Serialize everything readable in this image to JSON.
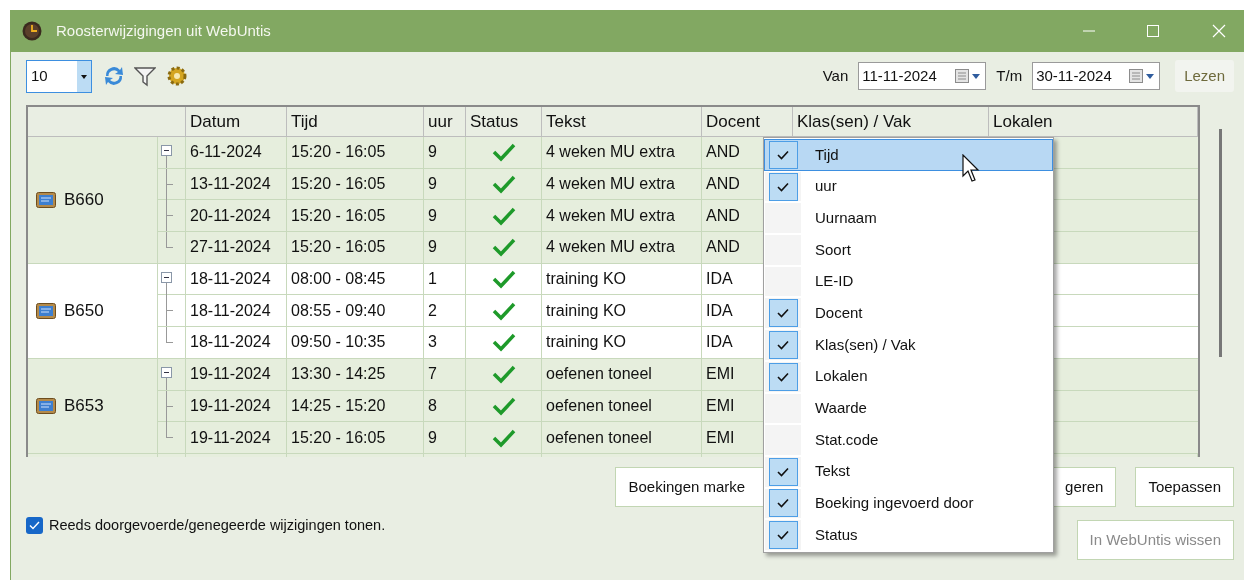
{
  "window": {
    "title": "Roosterwijzigingen uit WebUntis"
  },
  "toolbar": {
    "count": "10",
    "van_label": "Van",
    "van_date": "11-11-2024",
    "tm_label": "T/m",
    "tm_date": "30-11-2024",
    "read_button": {
      "label": "Lezen",
      "disabled": true
    }
  },
  "table": {
    "columns": [
      "Datum",
      "Tijd",
      "uur",
      "Status",
      "Tekst",
      "Docent",
      "Klas(sen) / Vak",
      "Lokalen"
    ],
    "groups": [
      {
        "name": "B660",
        "expanded": true,
        "rows": [
          {
            "datum": "6-11-2024",
            "tijd": "15:20 - 16:05",
            "uur": "9",
            "done": true,
            "tekst": "4 weken MU extra",
            "docent": "AND"
          },
          {
            "datum": "13-11-2024",
            "tijd": "15:20 - 16:05",
            "uur": "9",
            "done": true,
            "tekst": "4 weken MU extra",
            "docent": "AND"
          },
          {
            "datum": "20-11-2024",
            "tijd": "15:20 - 16:05",
            "uur": "9",
            "done": true,
            "tekst": "4 weken MU extra",
            "docent": "AND"
          },
          {
            "datum": "27-11-2024",
            "tijd": "15:20 - 16:05",
            "uur": "9",
            "done": true,
            "tekst": "4 weken MU extra",
            "docent": "AND"
          }
        ]
      },
      {
        "name": "B650",
        "expanded": true,
        "rows": [
          {
            "datum": "18-11-2024",
            "tijd": "08:00 - 08:45",
            "uur": "1",
            "done": true,
            "tekst": "training KO",
            "docent": "IDA"
          },
          {
            "datum": "18-11-2024",
            "tijd": "08:55 - 09:40",
            "uur": "2",
            "done": true,
            "tekst": "training KO",
            "docent": "IDA"
          },
          {
            "datum": "18-11-2024",
            "tijd": "09:50 - 10:35",
            "uur": "3",
            "done": true,
            "tekst": "training KO",
            "docent": "IDA"
          }
        ]
      },
      {
        "name": "B653",
        "expanded": true,
        "rows": [
          {
            "datum": "19-11-2024",
            "tijd": "13:30 - 14:25",
            "uur": "7",
            "done": true,
            "tekst": "oefenen toneel",
            "docent": "EMI"
          },
          {
            "datum": "19-11-2024",
            "tijd": "14:25 - 15:20",
            "uur": "8",
            "done": true,
            "tekst": "oefenen toneel",
            "docent": "EMI"
          },
          {
            "datum": "19-11-2024",
            "tijd": "15:20 - 16:05",
            "uur": "9",
            "done": true,
            "tekst": "oefenen toneel",
            "docent": "EMI"
          }
        ]
      }
    ]
  },
  "show_done": {
    "label": "Reeds doorgevoerde/genegeerde wijzigingen tonen.",
    "checked": true
  },
  "buttons": [
    {
      "label": "Boekingen marke",
      "disabled": false
    },
    {
      "label": "geren",
      "disabled": false
    },
    {
      "label": "Toepassen",
      "disabled": false
    },
    {
      "label": "In WebUntis wissen",
      "disabled": true
    }
  ],
  "column_menu": {
    "items": [
      {
        "label": "Tijd",
        "checked": true,
        "selected": true
      },
      {
        "label": "uur",
        "checked": true,
        "selected": false
      },
      {
        "label": "Uurnaam",
        "checked": false,
        "selected": false
      },
      {
        "label": "Soort",
        "checked": false,
        "selected": false
      },
      {
        "label": "LE-ID",
        "checked": false,
        "selected": false
      },
      {
        "label": "Docent",
        "checked": true,
        "selected": false
      },
      {
        "label": "Klas(sen) / Vak",
        "checked": true,
        "selected": false
      },
      {
        "label": "Lokalen",
        "checked": true,
        "selected": false
      },
      {
        "label": "Waarde",
        "checked": false,
        "selected": false
      },
      {
        "label": "Stat.code",
        "checked": false,
        "selected": false
      },
      {
        "label": "Tekst",
        "checked": true,
        "selected": false
      },
      {
        "label": "Boeking ingevoerd door",
        "checked": true,
        "selected": false
      },
      {
        "label": "Status",
        "checked": true,
        "selected": false
      }
    ]
  }
}
